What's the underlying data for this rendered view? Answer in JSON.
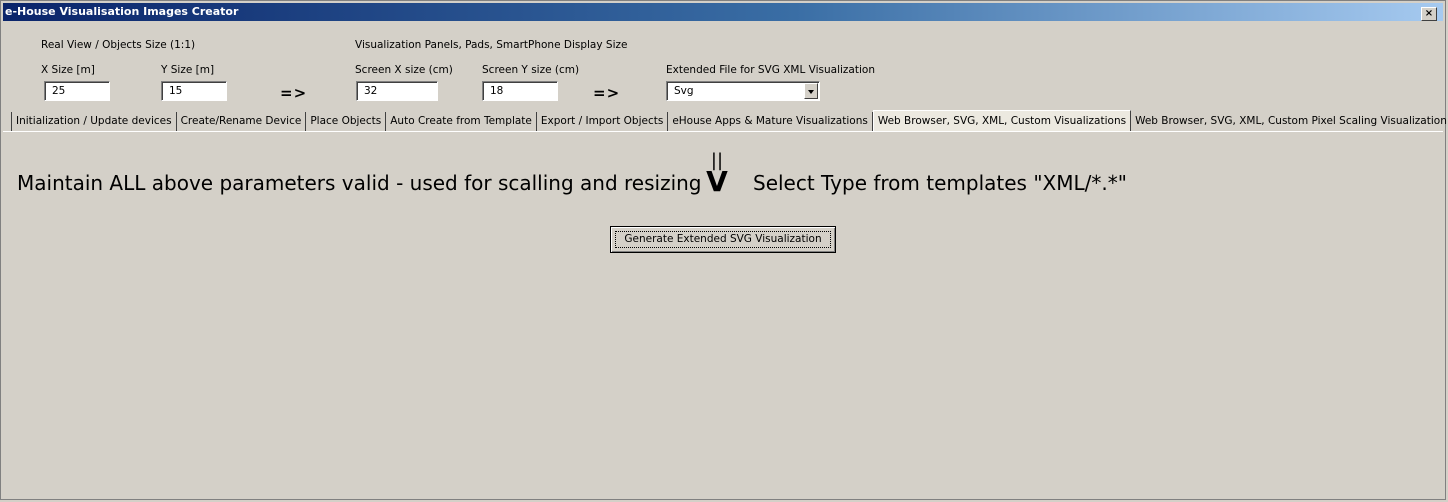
{
  "window": {
    "title": "e-House Visualisation Images Creator",
    "close_label": "×"
  },
  "real_view": {
    "heading": "Real View / Objects Size (1:1)",
    "x_label": "X Size [m]",
    "x_value": "25",
    "y_label": "Y Size [m]",
    "y_value": "15"
  },
  "screen": {
    "heading": "Visualization Panels, Pads, SmartPhone Display Size",
    "x_label": "Screen X size (cm)",
    "x_value": "32",
    "y_label": "Screen Y size (cm)",
    "y_value": "18"
  },
  "arrows": {
    "first": "=>",
    "second": "=>"
  },
  "extended": {
    "label": "Extended File for SVG XML Visualization",
    "selected": "Svg"
  },
  "tabs": [
    "Initialization / Update devices",
    "Create/Rename Device",
    "Place Objects",
    "Auto Create from Template",
    "Export / Import Objects",
    "eHouse Apps & Mature Visualizations",
    "Web Browser, SVG, XML, Custom Visualizations",
    "Web Browser, SVG, XML, Custom Pixel Scaling Visualization"
  ],
  "active_tab": 6,
  "content": {
    "instruction_left": "Maintain ALL above parameters valid - used for scalling and resizing",
    "marker_bars": "||",
    "marker_v": "V",
    "instruction_right": "Select Type from templates \"XML/*.*\"",
    "generate_button": "Generate Extended SVG Visualization"
  }
}
